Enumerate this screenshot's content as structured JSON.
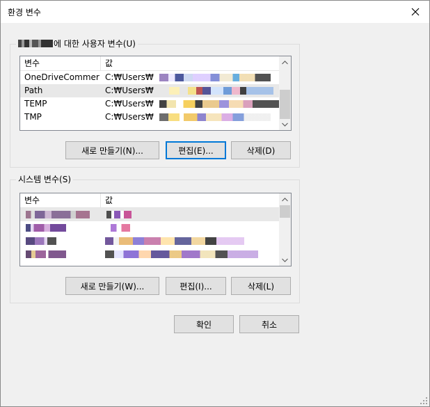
{
  "window": {
    "title": "환경 변수",
    "close_label": "✕"
  },
  "user_vars": {
    "group_label_suffix": "에 대한 사용자 변수(U)",
    "columns": [
      "변수",
      "값"
    ],
    "rows": [
      {
        "name": "OneDriveCommer...",
        "value": "C:₩Users₩"
      },
      {
        "name": "Path",
        "value": "C:₩Users₩"
      },
      {
        "name": "TEMP",
        "value": "C:₩Users₩"
      },
      {
        "name": "TMP",
        "value": "C:₩Users₩"
      }
    ],
    "buttons": {
      "new": "새로 만들기(N)...",
      "edit": "편집(E)...",
      "delete": "삭제(D)"
    }
  },
  "system_vars": {
    "group_label": "시스템 변수(S)",
    "columns": [
      "변수",
      "값"
    ],
    "buttons": {
      "new": "새로 만들기(W)...",
      "edit": "편집(I)...",
      "delete": "삭제(L)"
    }
  },
  "footer": {
    "ok": "확인",
    "cancel": "취소"
  },
  "colors": {
    "accent": "#0078d7",
    "selection": "#e8e8e8",
    "button_face": "#e1e1e1"
  }
}
